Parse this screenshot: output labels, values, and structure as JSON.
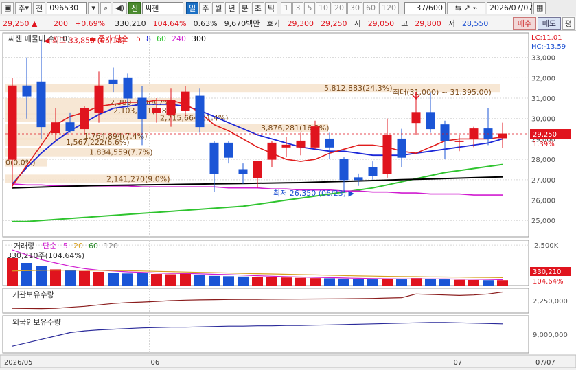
{
  "toolbar": {
    "icon1": "▣",
    "market": "주",
    "market_arrow": "▾",
    "prev_btn": "전",
    "code": "096530",
    "search_icon": "⌕",
    "dd_arrow": "▾",
    "speaker_icon": "◀)",
    "new_btn": "신",
    "name": "씨젠",
    "periods": [
      "일",
      "주",
      "월",
      "년",
      "분",
      "초",
      "틱"
    ],
    "selected_period": "일",
    "numbers": [
      "1",
      "3",
      "5",
      "10",
      "20",
      "30",
      "60",
      "120"
    ],
    "page_count": "37/600",
    "date": "2026/07/07",
    "cal_icon": "▦"
  },
  "quote": {
    "price": "29,250",
    "change_arrow": "▲",
    "change": "200",
    "change_pct": "+0.69%",
    "volume": "330,210",
    "vol_ratio": "104.64%",
    "turnover_rate": "0.63%",
    "amount": "9,670백만",
    "ask_label": "호가",
    "ask": "29,300",
    "bid": "29,250",
    "open_label": "시",
    "open": "29,050",
    "high_label": "고",
    "high": "29,800",
    "low_label": "저",
    "low": "28,550",
    "buy_btn": "매수",
    "sell_btn": "매도",
    "eval_btn": "평"
  },
  "price_panel": {
    "legend_title": "씨젠 매물대 수(10)",
    "ma_label": "종가 단순",
    "ma_periods": [
      "5",
      "8",
      "60",
      "240",
      "300"
    ],
    "ma_colors": [
      "#e01c1c",
      "#1c28d8",
      "#2fc42f",
      "#d01cd0",
      "#000000"
    ],
    "lc_label": "LC:11.01",
    "hc_label": "HC:-13.59",
    "current_price": "29,250",
    "current_pct": "1.39%",
    "max_label": "최고 33,850 (05/18)",
    "min_label": "최저 26,350 (06/23)",
    "mid_label": "최대(31,000) ~ 31,395.00)",
    "volume_profile": [
      {
        "label": "5,812,883(24.3%)",
        "price": 31500
      },
      {
        "label": "2,389,300(8.7%)",
        "price": 30800
      },
      {
        "label": "2,103,001(8.8%)",
        "price": 30400
      },
      {
        "label": "2,715,664(11.4%)",
        "price": 30050
      },
      {
        "label": "3,876,281(16.2%)",
        "price": 29550
      },
      {
        "label": "1,764,894(7.4%)",
        "price": 29150
      },
      {
        "label": "1,567,222(6.6%)",
        "price": 28850
      },
      {
        "label": "1,834,559(7.7%)",
        "price": 28350
      },
      {
        "label": "0(0.0%)",
        "price": 27850
      },
      {
        "label": "2,141,270(9.0%)",
        "price": 27050
      }
    ]
  },
  "volume_panel": {
    "label": "거래량",
    "ma_label": "단순",
    "ma_periods": [
      "5",
      "20",
      "60",
      "120"
    ],
    "ma_colors": [
      "#d01cd0",
      "#d8a020",
      "#2a8a2a",
      "#888888"
    ],
    "current_label": "330,210주(104.64%)",
    "axis_value": "330,210",
    "axis_pct": "104.64%",
    "ticks": [
      "2,500K"
    ]
  },
  "inst_panel": {
    "label": "기관보유수량",
    "ticks": [
      "2,250,000"
    ]
  },
  "foreign_panel": {
    "label": "외국인보유수량",
    "ticks": [
      "9,000,000"
    ]
  },
  "x_axis": {
    "labels": [
      "2026/05",
      "06",
      "07"
    ],
    "end_label": "07/07"
  },
  "chart_data": {
    "type": "candlestick",
    "title": "씨젠",
    "y_ticks": [
      25000,
      26000,
      27000,
      28000,
      29000,
      30000,
      31000,
      32000,
      33000
    ],
    "ylim": [
      24200,
      34200
    ],
    "candles": [
      {
        "o": 28000,
        "h": 32000,
        "l": 26600,
        "c": 31600
      },
      {
        "o": 31600,
        "h": 33000,
        "l": 30000,
        "c": 31100
      },
      {
        "o": 31800,
        "h": 33850,
        "l": 29000,
        "c": 29600
      },
      {
        "o": 29300,
        "h": 30500,
        "l": 28900,
        "c": 29800
      },
      {
        "o": 29800,
        "h": 30300,
        "l": 29300,
        "c": 29400
      },
      {
        "o": 29500,
        "h": 30600,
        "l": 29200,
        "c": 30500
      },
      {
        "o": 30300,
        "h": 32300,
        "l": 29800,
        "c": 31600
      },
      {
        "o": 31900,
        "h": 32500,
        "l": 31300,
        "c": 31700
      },
      {
        "o": 32000,
        "h": 32200,
        "l": 30500,
        "c": 31000
      },
      {
        "o": 31000,
        "h": 31600,
        "l": 28700,
        "c": 30000
      },
      {
        "o": 30300,
        "h": 31000,
        "l": 29800,
        "c": 30500
      },
      {
        "o": 30200,
        "h": 31500,
        "l": 29600,
        "c": 30900
      },
      {
        "o": 30400,
        "h": 31600,
        "l": 30100,
        "c": 31300
      },
      {
        "o": 31100,
        "h": 31500,
        "l": 29300,
        "c": 29600
      },
      {
        "o": 28800,
        "h": 28900,
        "l": 26400,
        "c": 27300
      },
      {
        "o": 28800,
        "h": 28900,
        "l": 27800,
        "c": 28100
      },
      {
        "o": 27500,
        "h": 27800,
        "l": 26800,
        "c": 27300
      },
      {
        "o": 27100,
        "h": 27900,
        "l": 26600,
        "c": 27900
      },
      {
        "o": 28000,
        "h": 28900,
        "l": 27600,
        "c": 28800
      },
      {
        "o": 28600,
        "h": 29100,
        "l": 28100,
        "c": 28700
      },
      {
        "o": 28600,
        "h": 29300,
        "l": 28200,
        "c": 28900
      },
      {
        "o": 28600,
        "h": 29900,
        "l": 28500,
        "c": 29600
      },
      {
        "o": 29000,
        "h": 29300,
        "l": 28000,
        "c": 28600
      },
      {
        "o": 28000,
        "h": 28100,
        "l": 26350,
        "c": 27000
      },
      {
        "o": 27100,
        "h": 27300,
        "l": 26700,
        "c": 27000
      },
      {
        "o": 27600,
        "h": 27900,
        "l": 27000,
        "c": 27200
      },
      {
        "o": 27300,
        "h": 30000,
        "l": 27100,
        "c": 29200
      },
      {
        "o": 29000,
        "h": 29500,
        "l": 27600,
        "c": 28100
      },
      {
        "o": 29800,
        "h": 31000,
        "l": 29200,
        "c": 30300
      },
      {
        "o": 30300,
        "h": 31300,
        "l": 29300,
        "c": 29500
      },
      {
        "o": 29700,
        "h": 29900,
        "l": 28000,
        "c": 28900
      },
      {
        "o": 28900,
        "h": 29200,
        "l": 28400,
        "c": 28900
      },
      {
        "o": 29000,
        "h": 29600,
        "l": 28600,
        "c": 29500
      },
      {
        "o": 29500,
        "h": 30500,
        "l": 28700,
        "c": 29000
      },
      {
        "o": 29050,
        "h": 29800,
        "l": 28550,
        "c": 29250
      }
    ],
    "ma5": [
      26700,
      27700,
      28700,
      29700,
      30100,
      30300,
      30600,
      30700,
      30800,
      30800,
      30900,
      30900,
      30700,
      30300,
      29700,
      29400,
      29000,
      28600,
      28300,
      28000,
      27900,
      28000,
      28300,
      28500,
      28700,
      28700,
      28600,
      28400,
      28300,
      28600,
      28900,
      29000,
      29000,
      29000,
      29100
    ],
    "ma8": [
      26800,
      27600,
      28300,
      28900,
      29400,
      29800,
      30200,
      30500,
      30600,
      30700,
      30700,
      30700,
      30600,
      30400,
      30100,
      29800,
      29500,
      29200,
      29000,
      28800,
      28600,
      28500,
      28400,
      28400,
      28300,
      28200,
      28200,
      28200,
      28300,
      28400,
      28500,
      28600,
      28700,
      28800,
      29000
    ],
    "ma60": [
      24950,
      24950,
      25000,
      25050,
      25100,
      25150,
      25200,
      25250,
      25300,
      25350,
      25400,
      25450,
      25500,
      25550,
      25600,
      25650,
      25700,
      25800,
      25900,
      26000,
      26100,
      26200,
      26300,
      26400,
      26500,
      26600,
      26750,
      26900,
      27050,
      27200,
      27350,
      27450,
      27550,
      27650,
      27750
    ],
    "ma240": [
      26800,
      26750,
      26750,
      26700,
      26700,
      26700,
      26700,
      26700,
      26700,
      26650,
      26650,
      26650,
      26650,
      26650,
      26650,
      26600,
      26600,
      26600,
      26550,
      26550,
      26500,
      26500,
      26500,
      26450,
      26450,
      26400,
      26400,
      26350,
      26350,
      26300,
      26300,
      26300,
      26250,
      26250,
      26250
    ],
    "ma300": [
      26600,
      26620,
      26640,
      26660,
      26680,
      26700,
      26720,
      26730,
      26740,
      26750,
      26760,
      26770,
      26780,
      26790,
      26800,
      26810,
      26820,
      26830,
      26840,
      26850,
      26860,
      26880,
      26900,
      26920,
      26940,
      26960,
      26980,
      27000,
      27020,
      27040,
      27060,
      27080,
      27100,
      27120,
      27140
    ],
    "volume": [
      1700,
      1400,
      1200,
      1000,
      950,
      900,
      850,
      800,
      750,
      800,
      720,
      700,
      760,
      680,
      600,
      580,
      560,
      540,
      520,
      500,
      480,
      460,
      450,
      430,
      400,
      380,
      420,
      380,
      460,
      420,
      380,
      350,
      340,
      330,
      330
    ],
    "vol_ma5": [
      2200,
      1900,
      1600,
      1400,
      1200,
      1050,
      950,
      900,
      850,
      820,
      780,
      760,
      750,
      730,
      700,
      680,
      650,
      610,
      580,
      550,
      530,
      510,
      490,
      470,
      450,
      430,
      420,
      410,
      410,
      410,
      410,
      400,
      390,
      380,
      360
    ],
    "vol_ma20": [
      900,
      920,
      940,
      950,
      950,
      945,
      940,
      930,
      920,
      900,
      880,
      860,
      840,
      820,
      800,
      780,
      760,
      740,
      720,
      700,
      680,
      660,
      640,
      620,
      600,
      585,
      570,
      560,
      550,
      540,
      530,
      520,
      510,
      500,
      490
    ],
    "inst_holding": [
      2150000,
      2148000,
      2146000,
      2150000,
      2160000,
      2170000,
      2185000,
      2200000,
      2210000,
      2215000,
      2222000,
      2230000,
      2235000,
      2238000,
      2240000,
      2242000,
      2243000,
      2244000,
      2245000,
      2246000,
      2247000,
      2248000,
      2249000,
      2250000,
      2252000,
      2254000,
      2258000,
      2262000,
      2300000,
      2295000,
      2290000,
      2285000,
      2290000,
      2300000,
      2320000
    ],
    "foreign_holding": [
      8400000,
      8500000,
      8600000,
      8700000,
      8800000,
      8850000,
      8880000,
      8900000,
      8920000,
      8940000,
      8950000,
      8960000,
      8960000,
      8970000,
      8980000,
      8990000,
      8990000,
      9000000,
      9000000,
      9010000,
      9010000,
      9020000,
      9030000,
      9040000,
      9050000,
      9060000,
      9070000,
      9080000,
      9090000,
      9100000,
      9100000,
      9090000,
      9080000,
      9070000,
      9060000
    ]
  }
}
